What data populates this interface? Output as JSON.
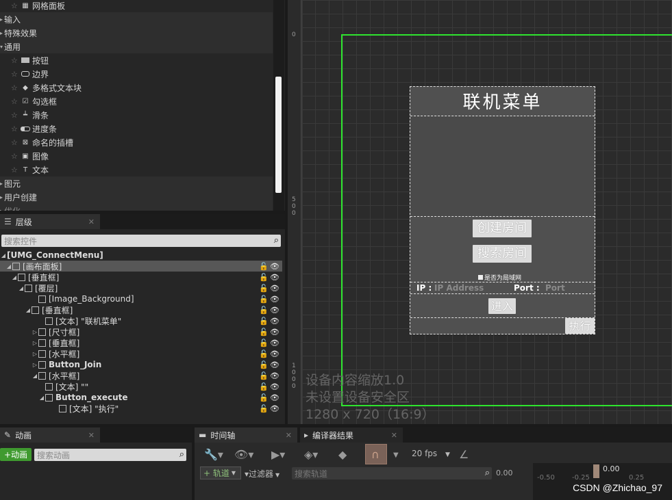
{
  "palette": {
    "items": [
      {
        "label": "网格面板",
        "icon": "grid-panel-icon",
        "type": "item"
      },
      {
        "label": "输入",
        "type": "category"
      },
      {
        "label": "特殊效果",
        "type": "category"
      },
      {
        "label": "通用",
        "type": "category"
      },
      {
        "label": "按钮",
        "icon": "button-icon",
        "type": "item"
      },
      {
        "label": "边界",
        "icon": "border-icon",
        "type": "item"
      },
      {
        "label": "多格式文本块",
        "icon": "rich-text-icon",
        "type": "item"
      },
      {
        "label": "勾选框",
        "icon": "checkbox-icon",
        "type": "item"
      },
      {
        "label": "滑条",
        "icon": "slider-icon",
        "type": "item"
      },
      {
        "label": "进度条",
        "icon": "progress-bar-icon",
        "type": "item"
      },
      {
        "label": "命名的插槽",
        "icon": "named-slot-icon",
        "type": "item"
      },
      {
        "label": "图像",
        "icon": "image-icon",
        "type": "item"
      },
      {
        "label": "文本",
        "icon": "text-icon",
        "type": "item"
      },
      {
        "label": "图元",
        "type": "category"
      },
      {
        "label": "用户创建",
        "type": "category"
      },
      {
        "label": "优化",
        "type": "category"
      }
    ]
  },
  "hierarchy": {
    "tab_label": "层级",
    "search_placeholder": "搜索控件",
    "root": "[UMG_ConnectMenu]",
    "rows": [
      {
        "label": "[画布面板]",
        "icon": "canvas-panel-icon",
        "selected": true
      },
      {
        "label": "[垂直框]",
        "icon": "vertical-box-icon"
      },
      {
        "label": "[覆层]",
        "icon": "overlay-icon"
      },
      {
        "label": "[Image_Background]",
        "icon": "image-icon"
      },
      {
        "label": "[垂直框]",
        "icon": "vertical-box-icon"
      },
      {
        "label": "[文本] \"联机菜单\"",
        "icon": "text-icon"
      },
      {
        "label": "[尺寸框]",
        "icon": "size-box-icon"
      },
      {
        "label": "[垂直框]",
        "icon": "vertical-box-icon"
      },
      {
        "label": "[水平框]",
        "icon": "horizontal-box-icon"
      },
      {
        "label": "Button_Join",
        "icon": "button-icon",
        "bold": true
      },
      {
        "label": "[水平框]",
        "icon": "horizontal-box-icon"
      },
      {
        "label": "[文本] \"\"",
        "icon": "text-icon"
      },
      {
        "label": "Button_execute",
        "icon": "button-icon",
        "bold": true
      },
      {
        "label": "[文本] \"执行\"",
        "icon": "text-icon"
      }
    ]
  },
  "viewport": {
    "ruler_labels": [
      "0",
      "5",
      "0",
      "0",
      "1",
      "0",
      "0",
      "0"
    ],
    "menu_title": "联机菜单",
    "create_room": "创建房间",
    "search_room": "搜索房间",
    "lan_label": "是否为局域网",
    "ip_label": "IP :",
    "ip_placeholder": "IP Address",
    "port_label": "Port :",
    "port_placeholder": "Port",
    "enter_button": "进入",
    "execute_button": "执行",
    "info_scale": "设备内容缩放1.0",
    "info_safezone": "未设置设备安全区",
    "info_resolution": "1280 x 720（16:9）",
    "frame_color": "#2ee52e"
  },
  "animations": {
    "tab_label": "动画",
    "add_button": "+动画",
    "search_placeholder": "搜索动画"
  },
  "timeline": {
    "tab_timeline": "时间轴",
    "tab_compiler": "编译器结果",
    "fps": "20 fps",
    "add_track": "+ 轨道",
    "filter": "过滤器",
    "search_track_placeholder": "搜索轨道",
    "time_value": "0.00",
    "ruler_values": [
      "-0.50",
      "-0.25",
      "0.00",
      "0.25"
    ],
    "watermark": "CSDN @Zhichao_97"
  }
}
